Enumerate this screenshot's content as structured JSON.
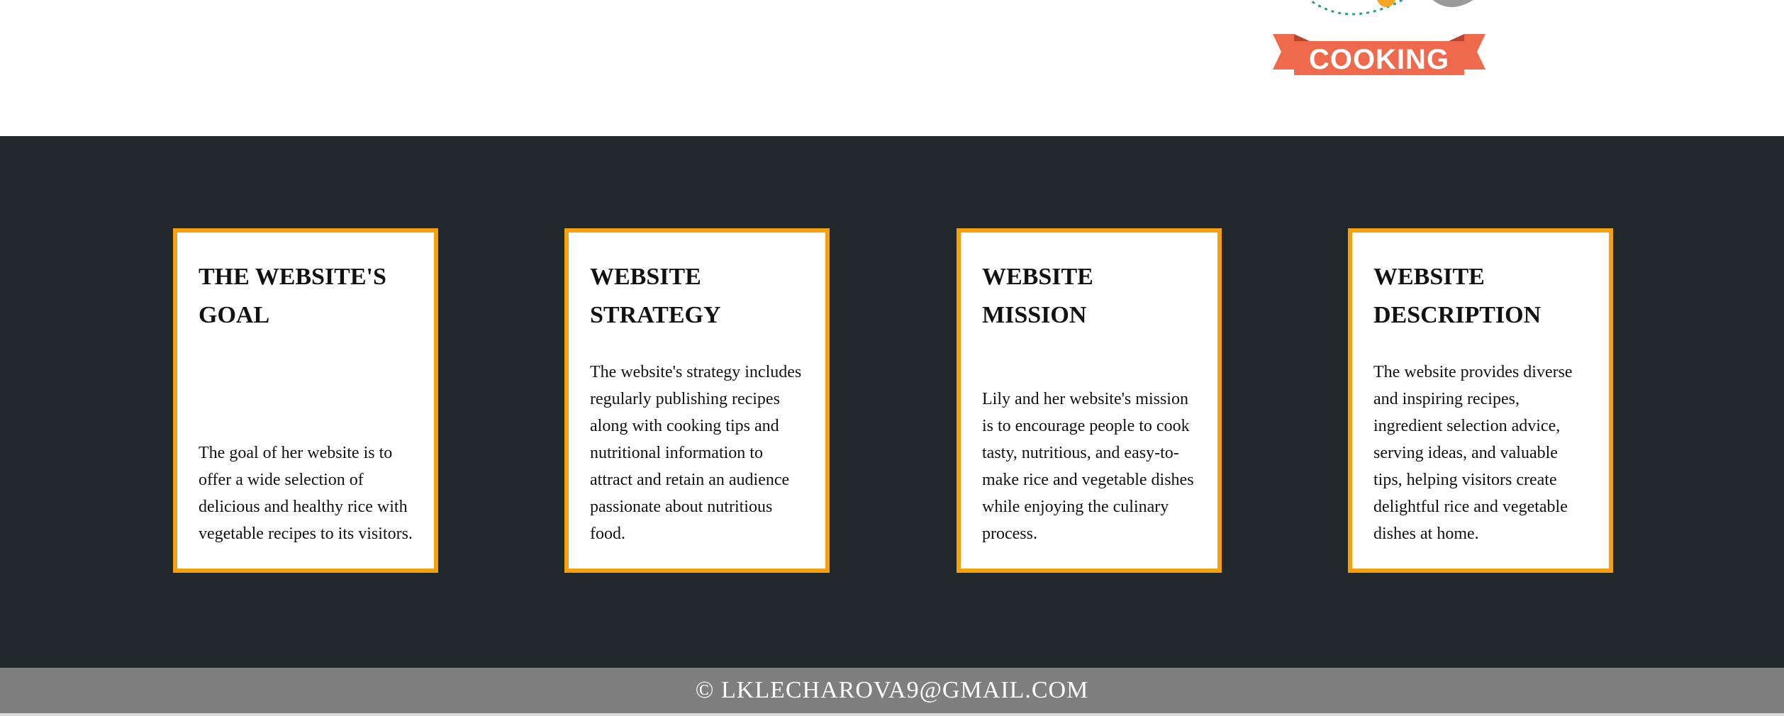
{
  "logo": {
    "label": "COOKING",
    "colors": {
      "ribbon": "#ef6a4c",
      "dots": "#2a9d8f",
      "accent": "#f5a623",
      "grey": "#9a9a9a"
    }
  },
  "cards": [
    {
      "title": "THE WEBSITE'S GOAL",
      "text": "The goal of her website is to offer a wide selection of delicious and healthy rice with vegetable recipes to its visitors."
    },
    {
      "title": "WEBSITE STRATEGY",
      "text": "The website's strategy includes regularly publishing recipes along with cooking tips and nutritional information to attract and retain an audience passionate about nutritious food."
    },
    {
      "title": "WEBSITE MISSION",
      "text": "Lily and her website's mission is to encourage people to cook tasty, nutritious, and easy-to-make rice and vegetable dishes while enjoying the culinary process."
    },
    {
      "title": "WEBSITE DESCRIPTION",
      "text": "The website provides diverse and inspiring recipes, ingredient selection advice, serving ideas, and valuable tips, helping visitors create delightful rice and vegetable dishes at home."
    }
  ],
  "footer": {
    "copyright": "© LKLECHAROVA9@GMAIL.COM"
  },
  "colors": {
    "section_bg": "#21282b",
    "card_border": "#f5a00f",
    "footer_bg": "#7f7f7f"
  }
}
